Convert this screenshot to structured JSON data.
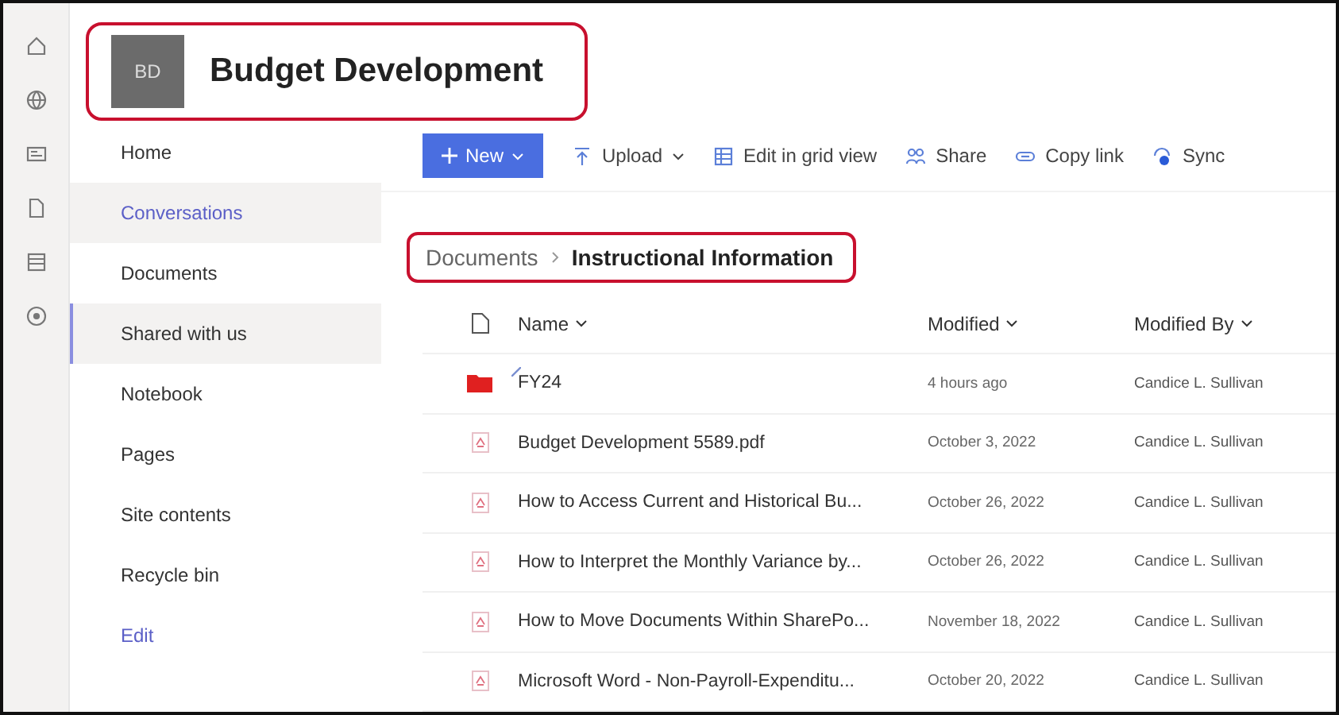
{
  "rail": [
    {
      "kind": "home"
    },
    {
      "kind": "globe"
    },
    {
      "kind": "news"
    },
    {
      "kind": "file"
    },
    {
      "kind": "list"
    },
    {
      "kind": "add"
    }
  ],
  "site": {
    "initials": "BD",
    "title": "Budget Development",
    "highlighted": true
  },
  "nav": [
    {
      "label": "Home",
      "selected": false,
      "hovered": false,
      "kind": "item"
    },
    {
      "label": "Conversations",
      "selected": false,
      "hovered": true,
      "kind": "item"
    },
    {
      "label": "Documents",
      "selected": false,
      "hovered": false,
      "kind": "item"
    },
    {
      "label": "Shared with us",
      "selected": true,
      "hovered": false,
      "kind": "item"
    },
    {
      "label": "Notebook",
      "selected": false,
      "hovered": false,
      "kind": "item"
    },
    {
      "label": "Pages",
      "selected": false,
      "hovered": false,
      "kind": "item"
    },
    {
      "label": "Site contents",
      "selected": false,
      "hovered": false,
      "kind": "item"
    },
    {
      "label": "Recycle bin",
      "selected": false,
      "hovered": false,
      "kind": "item"
    },
    {
      "label": "Edit",
      "selected": false,
      "hovered": false,
      "kind": "link"
    }
  ],
  "toolbar": [
    {
      "label": "New",
      "kind": "primary"
    },
    {
      "label": "Upload",
      "kind": "upload"
    },
    {
      "label": "Edit in grid view",
      "kind": "grid"
    },
    {
      "label": "Share",
      "kind": "share"
    },
    {
      "label": "Copy link",
      "kind": "link"
    },
    {
      "label": "Sync",
      "kind": "sync"
    }
  ],
  "breadcrumb": {
    "parent": "Documents",
    "current": "Instructional Information",
    "highlighted": true
  },
  "table": {
    "columns": [
      "Name",
      "Modified",
      "Modified By"
    ],
    "rows": [
      {
        "kind": "folder",
        "name": "FY24",
        "modified": "4 hours ago",
        "modified_by": "Candice L. Sullivan",
        "new": true
      },
      {
        "kind": "pdf",
        "name": "Budget Development 5589.pdf",
        "modified": "October 3, 2022",
        "modified_by": "Candice L. Sullivan",
        "new": false
      },
      {
        "kind": "pdf",
        "name": "How to Access Current and Historical Bu...",
        "modified": "October 26, 2022",
        "modified_by": "Candice L. Sullivan",
        "new": false
      },
      {
        "kind": "pdf",
        "name": "How to Interpret the Monthly Variance by...",
        "modified": "October 26, 2022",
        "modified_by": "Candice L. Sullivan",
        "new": false
      },
      {
        "kind": "pdf",
        "name": "How to Move Documents Within SharePo...",
        "modified": "November 18, 2022",
        "modified_by": "Candice L. Sullivan",
        "new": false
      },
      {
        "kind": "pdf",
        "name": "Microsoft Word - Non-Payroll-Expenditu...",
        "modified": "October 20, 2022",
        "modified_by": "Candice L. Sullivan",
        "new": false
      }
    ]
  }
}
